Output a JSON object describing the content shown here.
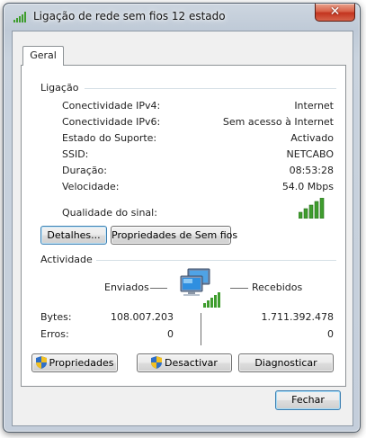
{
  "window": {
    "title": "Ligação de rede sem fios 12 estado",
    "close_glyph": "✕"
  },
  "tabs": [
    {
      "label": "Geral"
    }
  ],
  "connection": {
    "group_label": "Ligação",
    "rows": [
      {
        "label": "Conectividade IPv4:",
        "value": "Internet"
      },
      {
        "label": "Conectividade IPv6:",
        "value": "Sem acesso à Internet"
      },
      {
        "label": "Estado do Suporte:",
        "value": "Activado"
      },
      {
        "label": "SSID:",
        "value": "NETCABO"
      },
      {
        "label": "Duração:",
        "value": "08:53:28"
      },
      {
        "label": "Velocidade:",
        "value": "54.0 Mbps"
      }
    ],
    "signal_label": "Qualidade do sinal:",
    "signal_bars_lit": 5,
    "signal_bars_total": 5,
    "details_button": "Detalhes...",
    "wireless_properties_button": "Propriedades de Sem fios"
  },
  "activity": {
    "group_label": "Actividade",
    "sent_label": "Enviados",
    "received_label": "Recebidos",
    "bytes_label": "Bytes:",
    "bytes_sent": "108.007.203",
    "bytes_received": "1.711.392.478",
    "errors_label": "Erros:",
    "errors_sent": "0",
    "errors_received": "0"
  },
  "buttons": {
    "properties": "Propriedades",
    "disable": "Desactivar",
    "diagnose": "Diagnosticar",
    "close": "Fechar"
  },
  "colors": {
    "signal_green": "#3f9d2e",
    "close_red": "#c8391f",
    "focus_blue": "#3c7fb1"
  },
  "icons": {
    "title": "wireless-signal-icon",
    "activity": "network-computers-icon",
    "shield": "uac-shield-icon"
  }
}
